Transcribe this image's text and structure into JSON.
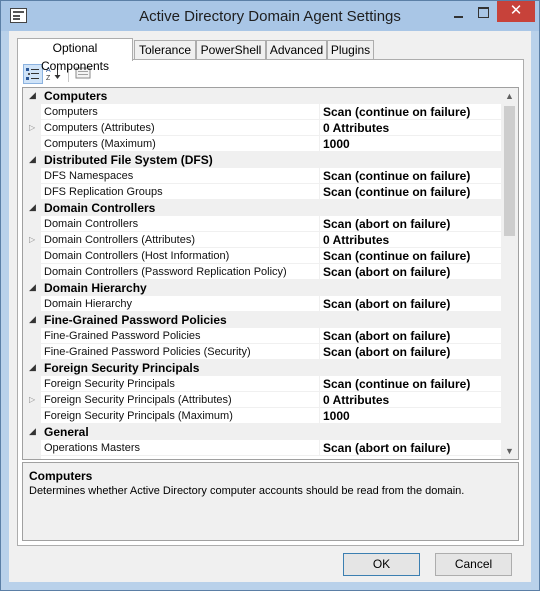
{
  "window": {
    "title": "Active Directory Domain Agent Settings",
    "close_glyph": "✕"
  },
  "tabs": [
    {
      "label": "Optional Components"
    },
    {
      "label": "Tolerance"
    },
    {
      "label": "PowerShell"
    },
    {
      "label": "Advanced"
    },
    {
      "label": "Plugins"
    }
  ],
  "toolbar": {
    "categorized": "categorized-view-icon",
    "alphabetical": "alphabetical-sort-icon",
    "pages": "property-pages-icon"
  },
  "grid": {
    "scroll_up": "▲",
    "scroll_down": "▼",
    "categories": [
      {
        "label": "Computers",
        "items": [
          {
            "name": "Computers",
            "value": "Scan (continue on failure)",
            "expandable": false
          },
          {
            "name": "Computers (Attributes)",
            "value": "0 Attributes",
            "expandable": true
          },
          {
            "name": "Computers (Maximum)",
            "value": "1000",
            "expandable": false
          }
        ]
      },
      {
        "label": "Distributed File System (DFS)",
        "items": [
          {
            "name": "DFS Namespaces",
            "value": "Scan (continue on failure)",
            "expandable": false
          },
          {
            "name": "DFS Replication Groups",
            "value": "Scan (continue on failure)",
            "expandable": false
          }
        ]
      },
      {
        "label": "Domain Controllers",
        "items": [
          {
            "name": "Domain Controllers",
            "value": "Scan (abort on failure)",
            "expandable": false
          },
          {
            "name": "Domain Controllers (Attributes)",
            "value": "0 Attributes",
            "expandable": true
          },
          {
            "name": "Domain Controllers (Host Information)",
            "value": "Scan (continue on failure)",
            "expandable": false
          },
          {
            "name": "Domain Controllers (Password Replication Policy)",
            "value": "Scan (abort on failure)",
            "expandable": false
          }
        ]
      },
      {
        "label": "Domain Hierarchy",
        "items": [
          {
            "name": "Domain Hierarchy",
            "value": "Scan (abort on failure)",
            "expandable": false
          }
        ]
      },
      {
        "label": "Fine-Grained Password Policies",
        "items": [
          {
            "name": "Fine-Grained Password Policies",
            "value": "Scan (abort on failure)",
            "expandable": false
          },
          {
            "name": "Fine-Grained Password Policies (Security)",
            "value": "Scan (abort on failure)",
            "expandable": false
          }
        ]
      },
      {
        "label": "Foreign Security Principals",
        "items": [
          {
            "name": "Foreign Security Principals",
            "value": "Scan (continue on failure)",
            "expandable": false
          },
          {
            "name": "Foreign Security Principals (Attributes)",
            "value": "0 Attributes",
            "expandable": true
          },
          {
            "name": "Foreign Security Principals (Maximum)",
            "value": "1000",
            "expandable": false
          }
        ]
      },
      {
        "label": "General",
        "items": [
          {
            "name": "Operations Masters",
            "value": "Scan (abort on failure)",
            "expandable": false
          }
        ]
      }
    ]
  },
  "help": {
    "title": "Computers",
    "text": "Determines whether Active Directory computer accounts should be read from the domain."
  },
  "buttons": {
    "ok": "OK",
    "cancel": "Cancel"
  }
}
